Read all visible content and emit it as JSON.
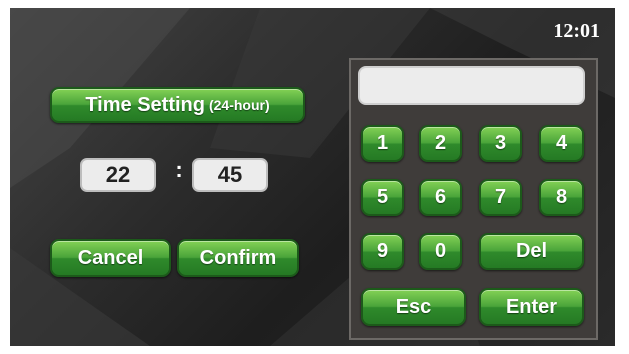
{
  "clock": "12:01",
  "time_setting": {
    "title": "Time Setting",
    "subtitle": "(24-hour)",
    "hours": "22",
    "separator": ":",
    "minutes": "45"
  },
  "actions": {
    "cancel_label": "Cancel",
    "confirm_label": "Confirm"
  },
  "keypad": {
    "display_value": "",
    "keys": [
      "1",
      "2",
      "3",
      "4",
      "5",
      "6",
      "7",
      "8",
      "9",
      "0",
      "Del",
      "Esc",
      "Enter"
    ]
  },
  "colors": {
    "button_green": "#4aa43a",
    "button_border": "#1c5a1a",
    "panel": "#3f3c3a",
    "background": "#2a2a2a",
    "field": "#ececec"
  }
}
